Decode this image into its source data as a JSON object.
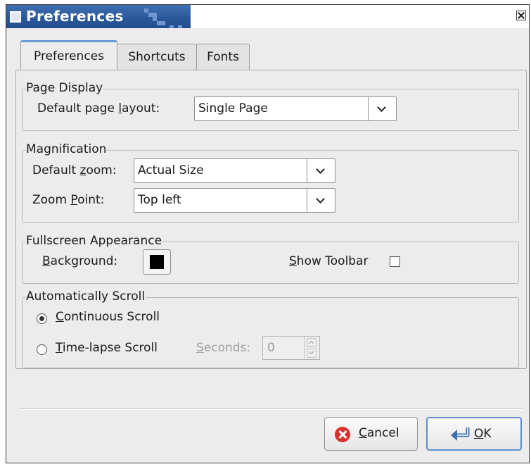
{
  "window": {
    "title": "Preferences"
  },
  "tabs": [
    {
      "label": "Preferences",
      "active": true
    },
    {
      "label": "Shortcuts",
      "active": false
    },
    {
      "label": "Fonts",
      "active": false
    }
  ],
  "page_display": {
    "title": "Page Display",
    "layout_label_pre": "Default page ",
    "layout_label_key": "l",
    "layout_label_post": "ayout:",
    "layout_value": "Single Page"
  },
  "magnification": {
    "title": "Magnification",
    "zoom_label_pre": "Default ",
    "zoom_label_key": "z",
    "zoom_label_post": "oom:",
    "zoom_value": "Actual Size",
    "point_label_pre": "Zoom ",
    "point_label_key": "P",
    "point_label_post": "oint:",
    "point_value": "Top left"
  },
  "fullscreen": {
    "title": "Fullscreen Appearance",
    "background_label_key": "B",
    "background_label_post": "ackground:",
    "background_color": "#000000",
    "toolbar_label_key": "S",
    "toolbar_label_post": "how Toolbar",
    "show_toolbar": false
  },
  "auto_scroll": {
    "title": "Automatically Scroll",
    "continuous_key": "C",
    "continuous_post": "ontinuous Scroll",
    "continuous_selected": true,
    "timelapse_key": "T",
    "timelapse_post": "ime-lapse Scroll",
    "seconds_key": "S",
    "seconds_post": "econds:",
    "seconds_value": "0"
  },
  "buttons": {
    "cancel_key": "C",
    "cancel_post": "ancel",
    "ok_key": "O",
    "ok_post": "K"
  },
  "colors": {
    "titlebar": "#2a579a",
    "active_tab_accent": "#6a9ad8",
    "cancel_icon": "#d9302b",
    "ok_border": "#5b8fd2"
  }
}
